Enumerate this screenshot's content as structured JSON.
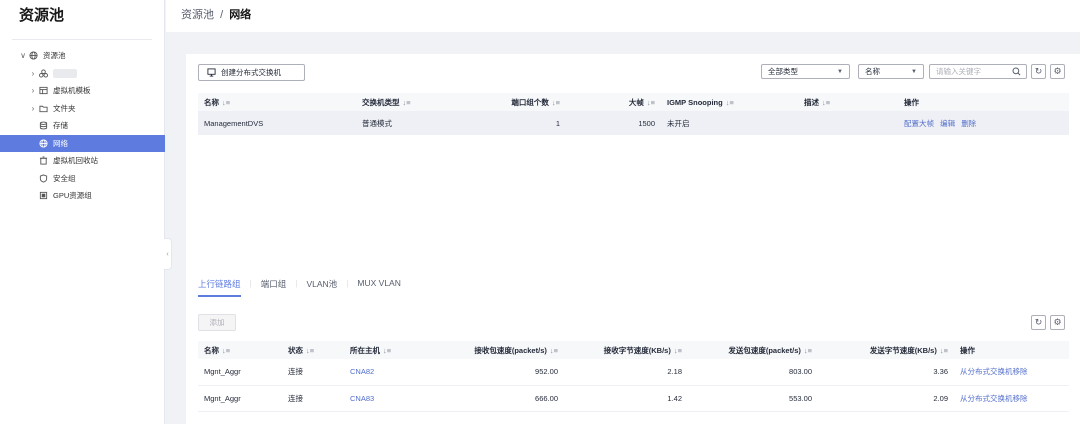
{
  "sidebar": {
    "title": "资源池",
    "items": [
      {
        "label": "资源池",
        "arrow": "∨",
        "icon": "globe-icon",
        "indent": 0
      },
      {
        "label": "",
        "arrow": "›",
        "icon": "cluster-icon",
        "indent": 1,
        "blurred": true
      },
      {
        "label": "虚拟机模板",
        "arrow": "›",
        "icon": "template-icon",
        "indent": 1
      },
      {
        "label": "文件夹",
        "arrow": "›",
        "icon": "folder-icon",
        "indent": 1
      },
      {
        "label": "存储",
        "arrow": "",
        "icon": "storage-icon",
        "indent": 1
      },
      {
        "label": "网络",
        "arrow": "",
        "icon": "network-icon",
        "indent": 1,
        "active": true
      },
      {
        "label": "虚拟机回收站",
        "arrow": "",
        "icon": "recycle-icon",
        "indent": 1
      },
      {
        "label": "安全组",
        "arrow": "",
        "icon": "shield-icon",
        "indent": 1
      },
      {
        "label": "GPU资源组",
        "arrow": "",
        "icon": "gpu-icon",
        "indent": 1
      }
    ]
  },
  "breadcrumb": {
    "parent": "资源池",
    "separator": "/",
    "current": "网络"
  },
  "toolbar": {
    "create_label": "创建分布式交换机",
    "type_select": "全部类型",
    "name_select": "名称",
    "search_placeholder": "请输入关键字"
  },
  "switch_table": {
    "headers": [
      "名称",
      "交换机类型",
      "端口组个数",
      "大帧",
      "IGMP Snooping",
      "描述",
      "操作"
    ],
    "rows": [
      {
        "name": "ManagementDVS",
        "type": "普通模式",
        "port_groups": "1",
        "jumbo": "1500",
        "igmp": "未开启",
        "desc": "",
        "actions": [
          "配置大帧",
          "编辑",
          "删除"
        ]
      }
    ]
  },
  "tabs": [
    "上行链路组",
    "端口组",
    "VLAN池",
    "MUX VLAN"
  ],
  "active_tab": 0,
  "bottom_toolbar": {
    "add_label": "添加"
  },
  "uplink_table": {
    "headers": [
      "名称",
      "状态",
      "所在主机",
      "接收包速度(packet/s)",
      "接收字节速度(KB/s)",
      "发送包速度(packet/s)",
      "发送字节速度(KB/s)",
      "操作"
    ],
    "rows": [
      {
        "name": "Mgnt_Aggr",
        "status": "连接",
        "host": "CNA82",
        "rx_pps": "952.00",
        "rx_kbs": "2.18",
        "tx_pps": "803.00",
        "tx_kbs": "3.36",
        "action": "从分布式交换机移除"
      },
      {
        "name": "Mgnt_Aggr",
        "status": "连接",
        "host": "CNA83",
        "rx_pps": "666.00",
        "rx_kbs": "1.42",
        "tx_pps": "553.00",
        "tx_kbs": "2.09",
        "action": "从分布式交换机移除"
      }
    ]
  },
  "colors": {
    "accent": "#5e7ce0",
    "link": "#526ecc",
    "row_highlight": "#eef0f5"
  }
}
